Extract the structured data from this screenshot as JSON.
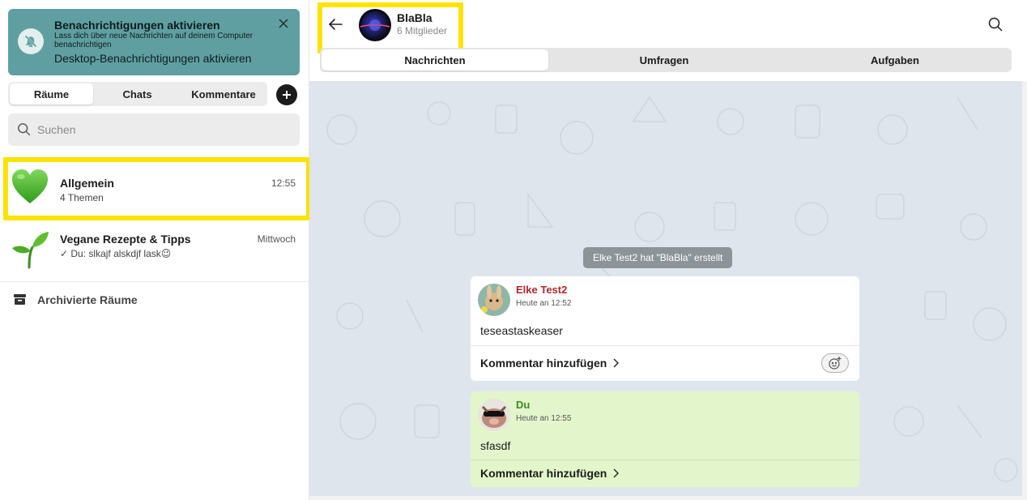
{
  "notification": {
    "title": "Benachrichtigungen aktivieren",
    "subtitle": "Lass dich über neue Nachrichten auf deinem Computer benachrichtigen",
    "action": "Desktop-Benachrichtigungen aktivieren",
    "icon": "bell-off-icon"
  },
  "sidebar_tabs": [
    {
      "label": "Räume",
      "active": true
    },
    {
      "label": "Chats",
      "active": false
    },
    {
      "label": "Kommentare",
      "active": false
    }
  ],
  "search": {
    "placeholder": "Suchen"
  },
  "rooms": [
    {
      "name": "Allgemein",
      "subtitle": "4 Themen",
      "time": "12:55",
      "icon": "green-heart-icon"
    },
    {
      "name": "Vegane Rezepte & Tipps",
      "subtitle": "✓ Du: slkajf alskdjf lask😉",
      "time": "Mittwoch",
      "icon": "seedling-icon"
    }
  ],
  "archived": {
    "label": "Archivierte Räume"
  },
  "header": {
    "group_name": "BlaBla",
    "members": "6 Mitglieder"
  },
  "main_tabs": [
    {
      "label": "Nachrichten",
      "active": true
    },
    {
      "label": "Umfragen",
      "active": false
    },
    {
      "label": "Aufgaben",
      "active": false
    }
  ],
  "system_message": "Elke Test2 hat \"BlaBla\" erstellt",
  "messages": [
    {
      "author": "Elke Test2",
      "time": "Heute an 12:52",
      "text": "teseastaskeaser",
      "comment_label": "Kommentar hinzufügen",
      "author_color": "#b3262e"
    },
    {
      "author": "Du",
      "time": "Heute an 12:55",
      "text": "sfasdf",
      "comment_label": "Kommentar hinzufügen",
      "author_color": "#3b8a23"
    }
  ],
  "colors": {
    "notification_bg": "#5f9fa2",
    "highlight": "#fce300",
    "chat_bg": "#dfe5ec",
    "own_message_bg": "#e3f6cb"
  }
}
